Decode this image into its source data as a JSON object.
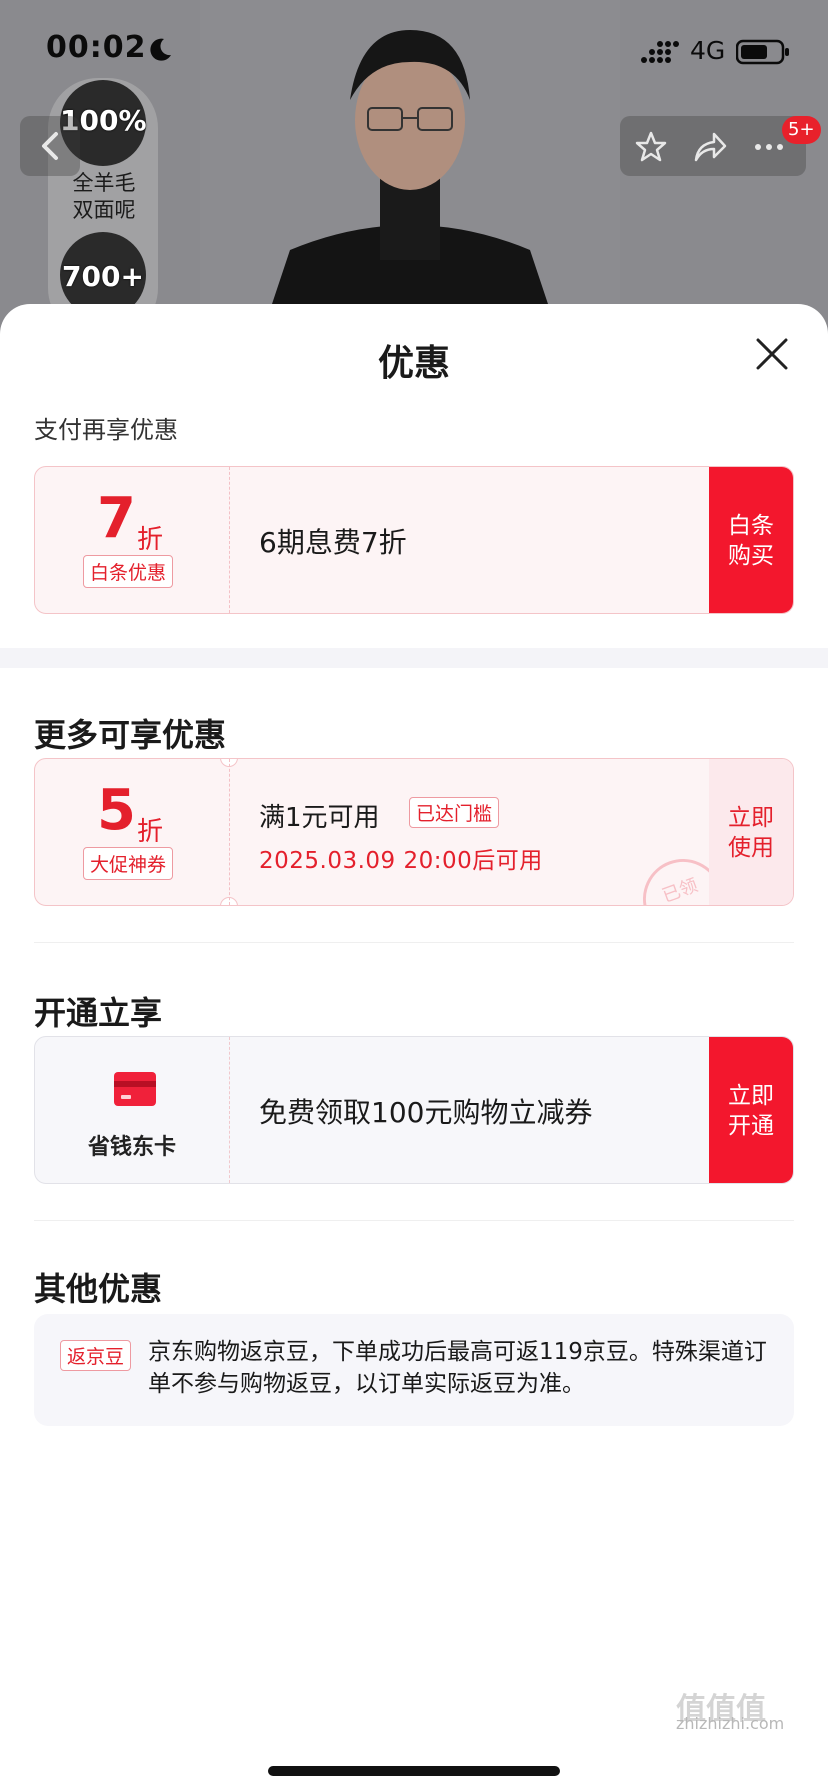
{
  "status_bar": {
    "time": "00:02",
    "network": "4G"
  },
  "background": {
    "features": [
      {
        "badge": "100%",
        "label": "全羊毛\n双面呢"
      },
      {
        "badge": "700+",
        "label": ""
      }
    ],
    "notification_badge": "5+"
  },
  "sheet": {
    "title": "优惠",
    "section_pay": {
      "subtitle": "支付再享优惠",
      "card": {
        "number": "7",
        "unit": "折",
        "tag": "白条优惠",
        "text": "6期息费7折",
        "button": "白条\n购买"
      }
    },
    "section_more": {
      "title": "更多可享优惠",
      "card": {
        "number": "5",
        "unit": "折",
        "tag": "大促神券",
        "condition": "满1元可用",
        "condition_badge": "已达门槛",
        "date": "2025.03.09 20:00后可用",
        "stamp": "已领",
        "button": "立即\n使用"
      }
    },
    "section_open": {
      "title": "开通立享",
      "card": {
        "icon_label": "省钱东卡",
        "text": "免费领取100元购物立减券",
        "button": "立即\n开通"
      }
    },
    "section_other": {
      "title": "其他优惠",
      "tag": "返京豆",
      "text": "京东购物返京豆，下单成功后最高可返119京豆。特殊渠道订单不参与购物返豆，以订单实际返豆为准。"
    }
  },
  "watermark": {
    "brand": "值值值",
    "site": "zhizhizhi.com"
  },
  "colors": {
    "accent": "#f3172d",
    "accent_text": "#e4202c",
    "card_bg": "#fdf4f5"
  }
}
